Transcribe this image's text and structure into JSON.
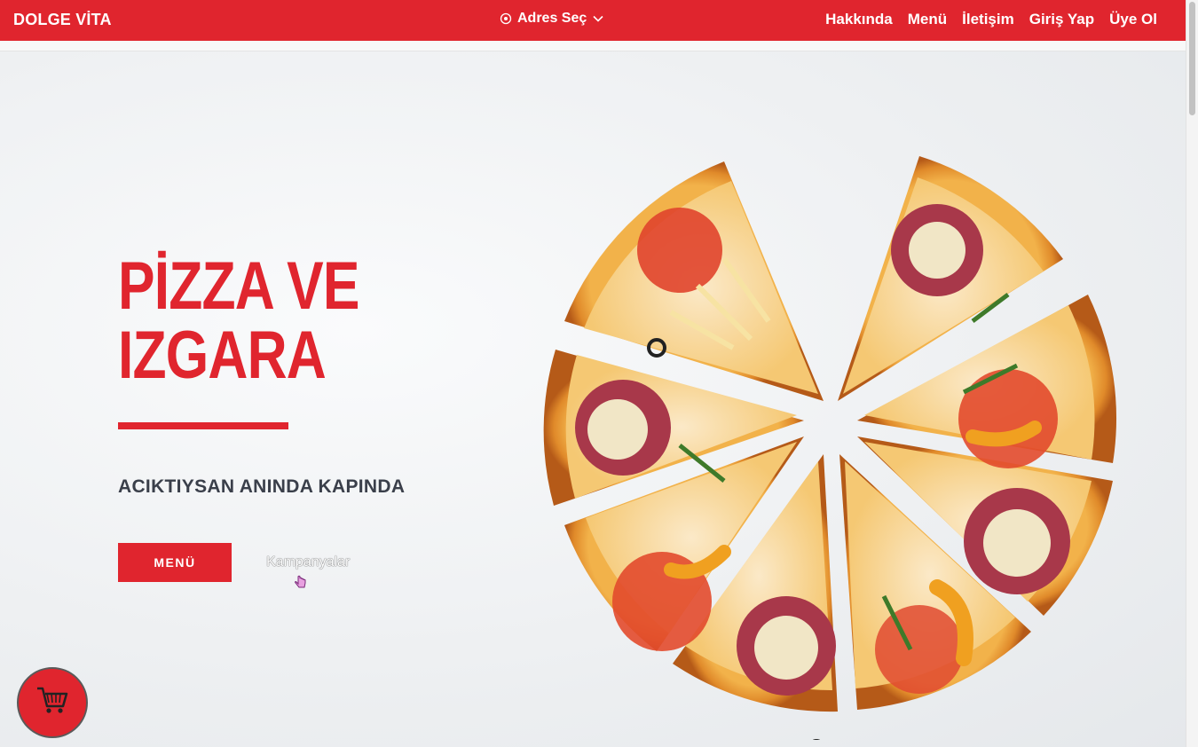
{
  "navbar": {
    "brand": "DOLGE VİTA",
    "address_label": "Adres Seç",
    "address_icon": "location-target-icon",
    "chevron_icon": "chevron-down-icon",
    "links": [
      "Hakkında",
      "Menü",
      "İletişim",
      "Giriş Yap",
      "Üye Ol"
    ]
  },
  "hero": {
    "title_line1": "PİZZA VE",
    "title_line2": "IZGARA",
    "subtitle": "ACIKTIYSAN ANINDA KAPINDA",
    "menu_button": "MENÜ",
    "campaign_link": "Kampanyalar",
    "image": "pizza-slices-image"
  },
  "cart": {
    "icon": "shopping-cart-icon"
  },
  "colors": {
    "brand_red": "#e0252e",
    "subtitle": "#3a3f4a"
  }
}
